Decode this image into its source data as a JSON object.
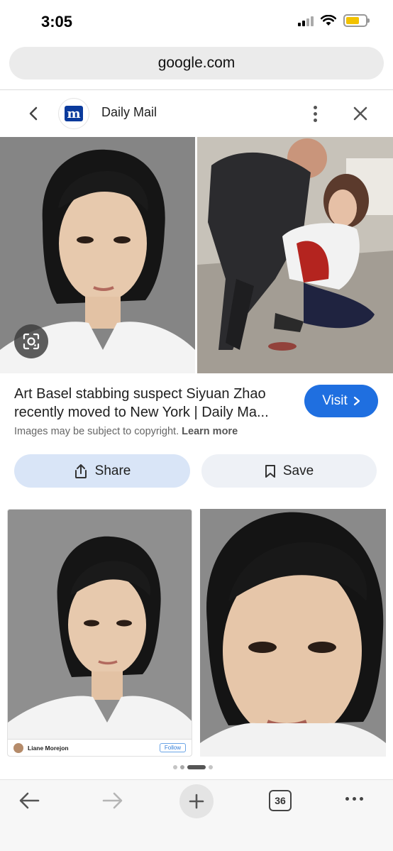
{
  "status": {
    "time": "3:05"
  },
  "browser": {
    "url": "google.com",
    "tab_count": "36"
  },
  "source": {
    "name": "Daily Mail",
    "logo_letter": "m"
  },
  "result": {
    "title": "Art Basel stabbing suspect Siyuan Zhao recently moved to New York | Daily Ma...",
    "visit_label": "Visit",
    "copyright_text": "Images may be subject to copyright.",
    "learn_more": "Learn more",
    "share_label": "Share",
    "save_label": "Save"
  },
  "related": {
    "embed_name": "Liane Morejon",
    "embed_follow": "Follow"
  },
  "colors": {
    "accent": "#1f6fe0",
    "share_bg": "#d9e5f7",
    "save_bg": "#eef1f6"
  },
  "icons": [
    "back-chevron-icon",
    "daily-mail-logo",
    "more-vert-icon",
    "close-icon",
    "lens-icon",
    "chevron-right-icon",
    "share-icon",
    "bookmark-icon",
    "back-arrow-icon",
    "forward-arrow-icon",
    "plus-icon",
    "tabs-icon",
    "more-horiz-icon"
  ]
}
